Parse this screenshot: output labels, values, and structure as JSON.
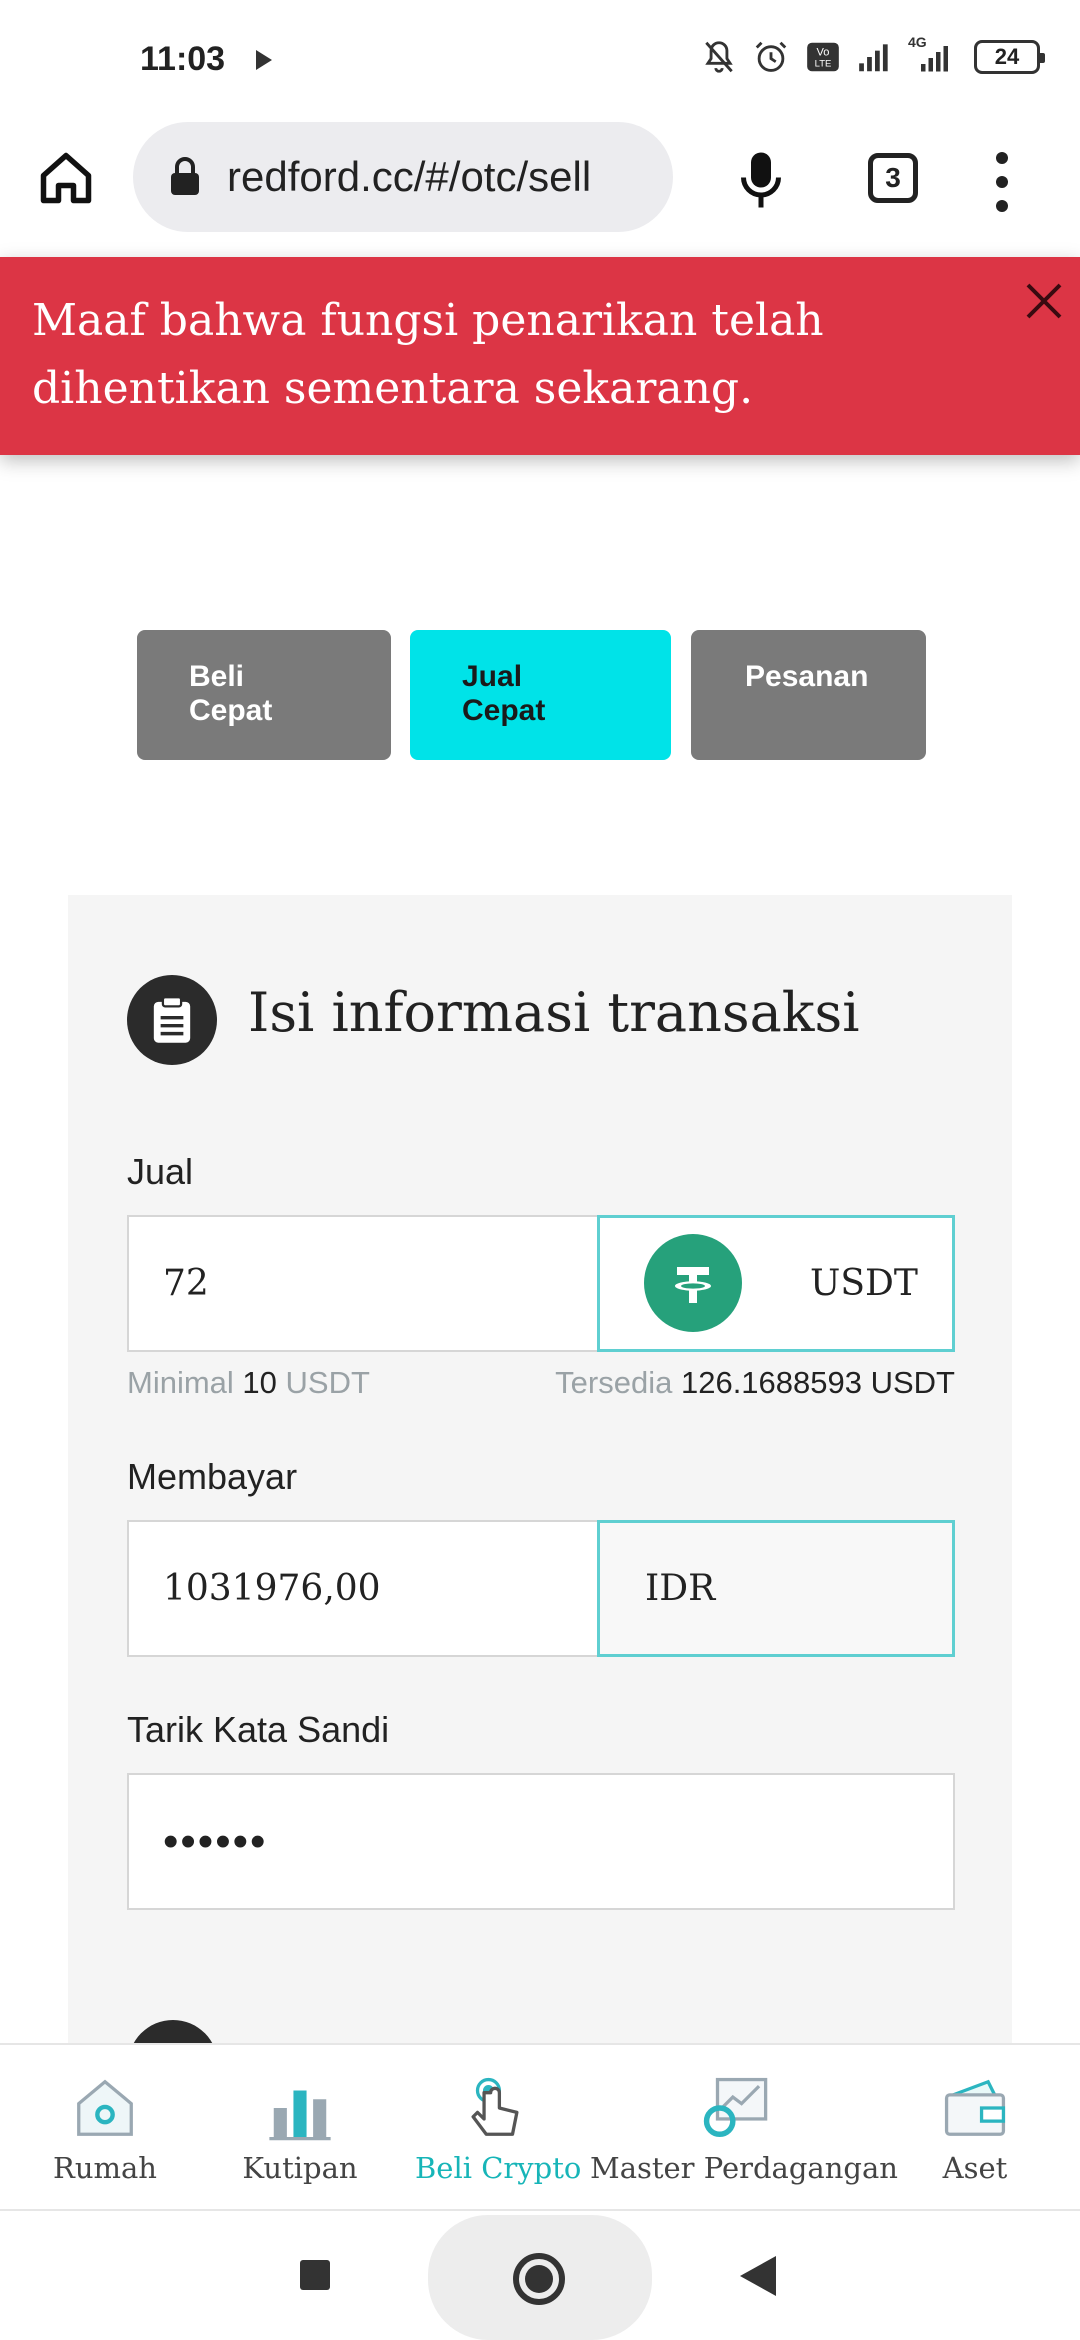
{
  "status_bar": {
    "time": "11:03",
    "battery": "24",
    "network_label": "4G"
  },
  "browser": {
    "url": "redford.cc/#/otc/sell",
    "tab_count": "3"
  },
  "banner": {
    "message": "Maaf bahwa fungsi penarikan telah dihentikan sementara sekarang."
  },
  "tabs": [
    {
      "label": "Beli Cepat",
      "active": false
    },
    {
      "label": "Jual Cepat",
      "active": true
    },
    {
      "label": "Pesanan",
      "active": false
    }
  ],
  "form": {
    "title": "Isi informasi transaksi",
    "sell": {
      "label": "Jual",
      "value": "72",
      "currency": "USDT",
      "min_label": "Minimal",
      "min_value": "10",
      "min_unit": "USDT",
      "available_label": "Tersedia",
      "available_value": "126.1688593 USDT"
    },
    "pay": {
      "label": "Membayar",
      "value": "1031976,00",
      "currency": "IDR"
    },
    "password": {
      "label": "Tarik Kata Sandi",
      "value": "••••••"
    }
  },
  "bottom_nav": [
    {
      "label": "Rumah",
      "icon": "home-icon",
      "active": false
    },
    {
      "label": "Kutipan",
      "icon": "bar-chart-icon",
      "active": false
    },
    {
      "label": "Beli Crypto",
      "icon": "touch-icon",
      "active": true
    },
    {
      "label": "Master Perdagangan",
      "icon": "trading-chart-icon",
      "active": false
    },
    {
      "label": "Aset",
      "icon": "wallet-icon",
      "active": false
    }
  ],
  "colors": {
    "banner": "#dc3545",
    "active_tab": "#00e3e8",
    "inactive_tab": "#7a7a7a",
    "accent": "#17b5b8",
    "tether": "#26a17b"
  }
}
